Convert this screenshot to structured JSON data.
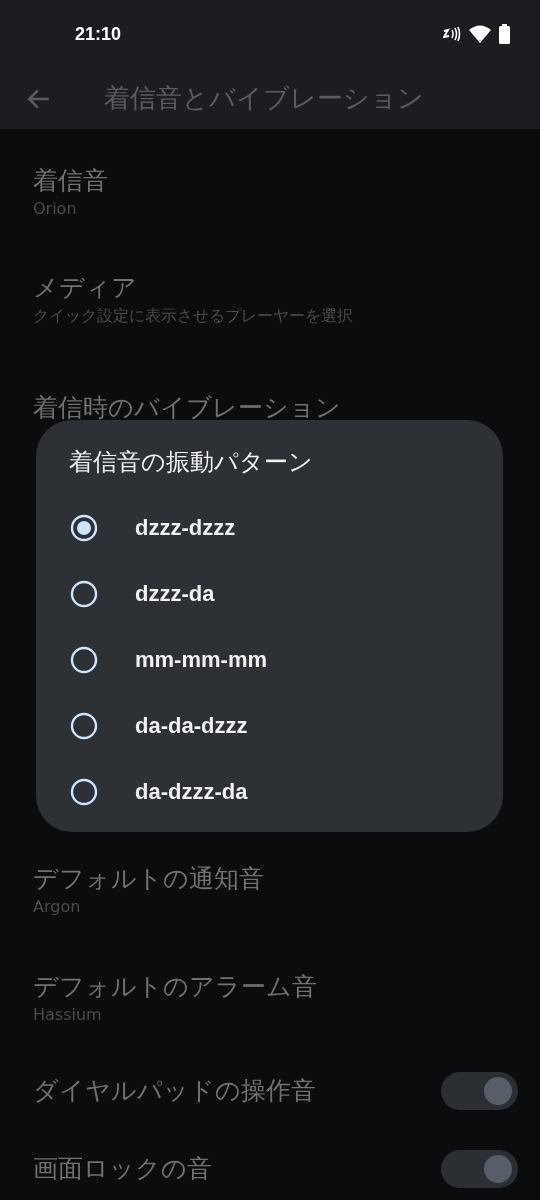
{
  "status_bar": {
    "time": "21:10"
  },
  "toolbar": {
    "title": "着信音とバイブレーション"
  },
  "settings_top": [
    {
      "kind": "text",
      "title": "着信音",
      "subtitle": "Orion"
    },
    {
      "kind": "text",
      "title": "メディア",
      "subtitle": "クイック設定に表示させるプレーヤーを選択"
    },
    {
      "kind": "text",
      "title": "着信時のバイブレーション"
    }
  ],
  "settings_bottom": [
    {
      "kind": "text",
      "title": "デフォルトの通知音",
      "subtitle": "Argon"
    },
    {
      "kind": "text",
      "title": "デフォルトのアラーム音",
      "subtitle": "Hassium"
    },
    {
      "kind": "toggle",
      "title": "ダイヤルパッドの操作音",
      "on": true
    },
    {
      "kind": "toggle",
      "title": "画面ロックの音",
      "on": true
    }
  ],
  "dialog": {
    "title": "着信音の振動パターン",
    "options": [
      {
        "label": "dzzz-dzzz",
        "selected": true
      },
      {
        "label": "dzzz-da",
        "selected": false
      },
      {
        "label": "mm-mm-mm",
        "selected": false
      },
      {
        "label": "da-da-dzzz",
        "selected": false
      },
      {
        "label": "da-dzzz-da",
        "selected": false
      }
    ]
  }
}
